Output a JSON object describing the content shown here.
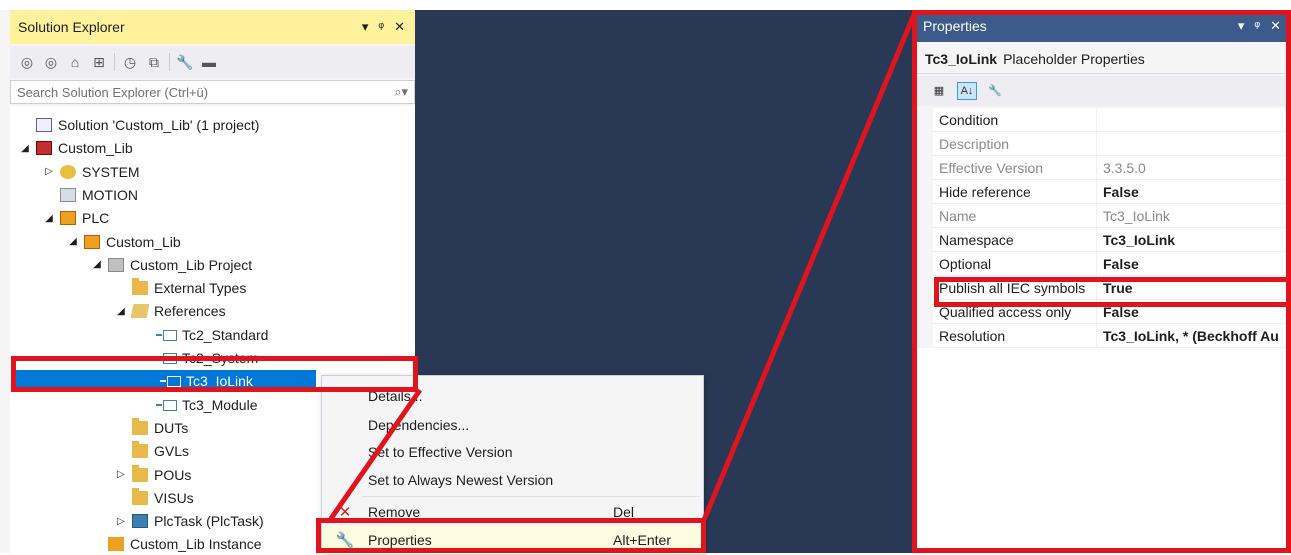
{
  "solution_explorer": {
    "title": "Solution Explorer",
    "title_buttons": [
      "▾",
      "ᵠ",
      "✕"
    ],
    "search_placeholder": "Search Solution Explorer (Ctrl+ü)",
    "tree": [
      {
        "label": "Solution 'Custom_Lib' (1 project)",
        "icon": "solution-icon",
        "level": 0,
        "expander": ""
      },
      {
        "label": "Custom_Lib",
        "icon": "twincat-project-icon",
        "level": 0,
        "expander": "◢"
      },
      {
        "label": "SYSTEM",
        "icon": "system-icon",
        "level": 1,
        "expander": "▷"
      },
      {
        "label": "MOTION",
        "icon": "motion-icon",
        "level": 1,
        "expander": ""
      },
      {
        "label": "PLC",
        "icon": "plc-icon",
        "level": 1,
        "expander": "◢"
      },
      {
        "label": "Custom_Lib",
        "icon": "plc-project-icon",
        "level": 2,
        "expander": "◢"
      },
      {
        "label": "Custom_Lib Project",
        "icon": "plc-subproject-icon",
        "level": 3,
        "expander": "◢"
      },
      {
        "label": "External Types",
        "icon": "folder-icon",
        "level": 4,
        "expander": ""
      },
      {
        "label": "References",
        "icon": "folder-open-icon",
        "level": 4,
        "expander": "◢"
      },
      {
        "label": "Tc2_Standard",
        "icon": "library-reference-icon",
        "level": 5,
        "expander": ""
      },
      {
        "label": "Tc2_System",
        "icon": "library-reference-icon",
        "level": 5,
        "expander": ""
      },
      {
        "label": "Tc3_IoLink",
        "icon": "library-placeholder-icon",
        "level": 5,
        "expander": "",
        "selected": true
      },
      {
        "label": "Tc3_Module",
        "icon": "library-reference-icon",
        "level": 5,
        "expander": ""
      },
      {
        "label": "DUTs",
        "icon": "folder-icon",
        "level": 4,
        "expander": ""
      },
      {
        "label": "GVLs",
        "icon": "folder-icon",
        "level": 4,
        "expander": ""
      },
      {
        "label": "POUs",
        "icon": "folder-icon",
        "level": 4,
        "expander": "▷"
      },
      {
        "label": "VISUs",
        "icon": "folder-icon",
        "level": 4,
        "expander": ""
      },
      {
        "label": "PlcTask (PlcTask)",
        "icon": "task-icon",
        "level": 4,
        "expander": "▷"
      },
      {
        "label": "Custom_Lib Instance",
        "icon": "plc-instance-icon",
        "level": 3,
        "expander": ""
      }
    ]
  },
  "context_menu": {
    "items": [
      {
        "label": "Details...",
        "shortcut": "",
        "icon": ""
      },
      {
        "label": "Dependencies...",
        "shortcut": "",
        "icon": ""
      },
      {
        "label": "Set to Effective Version",
        "shortcut": "",
        "icon": ""
      },
      {
        "label": "Set to Always Newest Version",
        "shortcut": "",
        "icon": ""
      },
      {
        "label": "Remove",
        "shortcut": "Del",
        "icon": "remove-icon"
      },
      {
        "label": "Properties",
        "shortcut": "Alt+Enter",
        "icon": "wrench-icon"
      }
    ]
  },
  "properties": {
    "title": "Properties",
    "object_name": "Tc3_IoLink",
    "object_type": "Placeholder Properties",
    "rows": [
      {
        "name": "Condition",
        "value": "",
        "readonly": false,
        "bold": false
      },
      {
        "name": "Description",
        "value": "",
        "readonly": true,
        "bold": false
      },
      {
        "name": "Effective Version",
        "value": "3.3.5.0",
        "readonly": true,
        "bold": false
      },
      {
        "name": "Hide reference",
        "value": "False",
        "readonly": false,
        "bold": true
      },
      {
        "name": "Name",
        "value": "Tc3_IoLink",
        "readonly": true,
        "bold": false
      },
      {
        "name": "Namespace",
        "value": "Tc3_IoLink",
        "readonly": false,
        "bold": true
      },
      {
        "name": "Optional",
        "value": "False",
        "readonly": false,
        "bold": true
      },
      {
        "name": "Publish all IEC symbols",
        "value": "True",
        "readonly": false,
        "bold": true
      },
      {
        "name": "Qualified access only",
        "value": "False",
        "readonly": false,
        "bold": true
      },
      {
        "name": "Resolution",
        "value": "Tc3_IoLink, * (Beckhoff Au",
        "readonly": false,
        "bold": true
      }
    ]
  },
  "colors": {
    "annotation_red": "#e1141e",
    "selection_blue": "#0078d7",
    "ide_background": "#293955",
    "active_title": "#fff29d",
    "properties_title": "#3c5a8a"
  }
}
